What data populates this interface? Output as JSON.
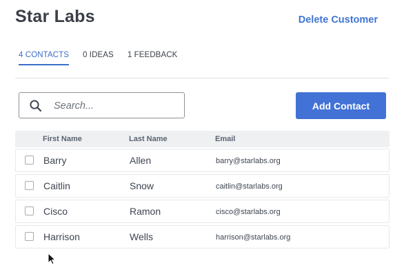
{
  "header": {
    "title": "Star Labs",
    "delete_label": "Delete Customer"
  },
  "tabs": [
    {
      "label": "4 CONTACTS",
      "active": true
    },
    {
      "label": "0 IDEAS",
      "active": false
    },
    {
      "label": "1 FEEDBACK",
      "active": false
    }
  ],
  "search": {
    "placeholder": "Search...",
    "value": "",
    "icon": "search-icon"
  },
  "add_contact_label": "Add Contact",
  "table": {
    "columns": [
      "First Name",
      "Last Name",
      "Email"
    ],
    "rows": [
      {
        "first": "Barry",
        "last": "Allen",
        "email": "barry@starlabs.org",
        "checked": false
      },
      {
        "first": "Caitlin",
        "last": "Snow",
        "email": "caitlin@starlabs.org",
        "checked": false
      },
      {
        "first": "Cisco",
        "last": "Ramon",
        "email": "cisco@starlabs.org",
        "checked": false
      },
      {
        "first": "Harrison",
        "last": "Wells",
        "email": "harrison@starlabs.org",
        "checked": false
      }
    ]
  },
  "colors": {
    "accent": "#4272d6",
    "link": "#3f74d4",
    "title": "#3a3f47"
  }
}
